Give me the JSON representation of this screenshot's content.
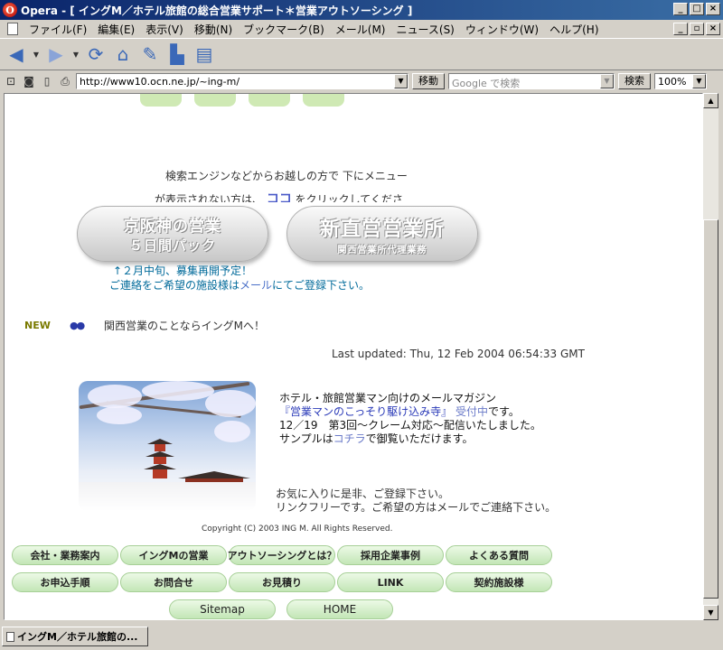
{
  "window": {
    "title": "Opera - [ イングM／ホテル旅館の総合営業サポート＊営業アウトソーシング ]",
    "app_logo": "O",
    "buttons": [
      "_",
      "□",
      "×"
    ],
    "mdi_buttons": [
      "_",
      "▫",
      "×"
    ]
  },
  "menu": [
    "ファイル(F)",
    "編集(E)",
    "表示(V)",
    "移動(N)",
    "ブックマーク(B)",
    "メール(M)",
    "ニュース(S)",
    "ウィンドウ(W)",
    "ヘルプ(H)"
  ],
  "toolbar": {
    "icons": [
      "back-arrow-icon",
      "forward-arrow-icon",
      "reload-icon",
      "home-icon",
      "hotlist-icon",
      "print-icon",
      "document-icon"
    ]
  },
  "address": {
    "url": "http://www10.ocn.ne.jp/~ing-m/",
    "go_label": "移動",
    "search_placeholder": "Google で検索",
    "search_label": "検索",
    "zoom": "100%"
  },
  "page": {
    "notice_line1": "検索エンジンなどからお越しの方で 下にメニュー",
    "notice_line2_pre": "が表示されない方は、",
    "notice_link": "ココ",
    "notice_line2_post": "をクリックしてくださ",
    "banner1": {
      "line1": "京阪神の営業",
      "line2": "５日間パック"
    },
    "banner2": {
      "line1": "新直営営業所",
      "line2": "関西営業所代理業務"
    },
    "recruit_line1": "↑２月中旬、募集再開予定！",
    "recruit_line2_pre": "ご連絡をご希望の施設様は",
    "recruit_line2_link": "メール",
    "recruit_line2_post": "にてご登録下さい。",
    "new_label": "NEW",
    "new_dots": "●●",
    "new_text": "関西営業のことならイングMへ！",
    "last_updated": "Last updated: Thu, 12 Feb 2004 06:54:33 GMT",
    "mag_line1": "ホテル・旅館営業マン向けのメールマガジン",
    "mag_title": "『営業マンのこっそり駆け込み寺』",
    "mag_status": "受付中",
    "mag_status_post": "です。",
    "mag_line3": "12／19　第3回～クレーム対応～配信いたしました。",
    "mag_line4_pre": "サンプルは",
    "mag_line4_link": "コチラ",
    "mag_line4_post": "で御覧いただけます。",
    "fav_line1": "お気に入りに是非、ご登録下さい。",
    "fav_line2": "リンクフリーです。ご希望の方はメールでご連絡下さい。",
    "copyright": "Copyright (C) 2003 ING M. All Rights Reserved."
  },
  "nav": {
    "row1": [
      "会社・業務案内",
      "イングMの営業",
      "アウトソーシングとは？",
      "採用企業事例",
      "よくある質問"
    ],
    "row2": [
      "お申込手順",
      "お問合せ",
      "お見積り",
      "LINK",
      "契約施設様"
    ],
    "row3": [
      "Sitemap",
      "HOME"
    ]
  },
  "status": {
    "tab_label": "イングM／ホテル旅館の..."
  }
}
